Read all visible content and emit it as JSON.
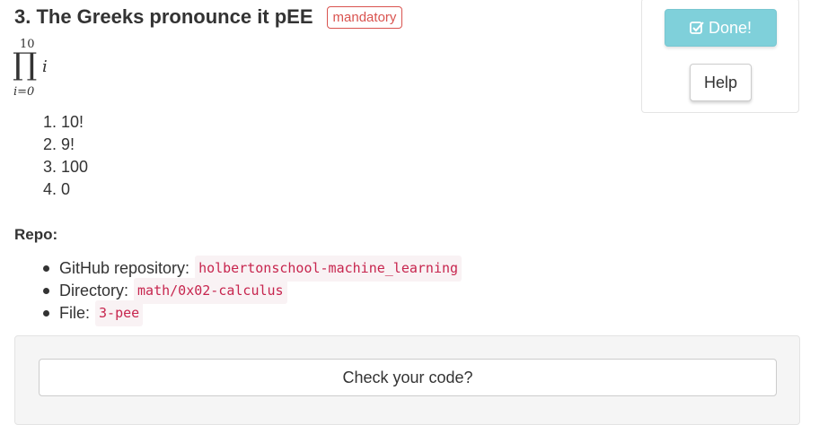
{
  "task": {
    "title": "3. The Greeks pronounce it pEE",
    "badge": "mandatory"
  },
  "side_panel": {
    "done_label": "Done!",
    "help_label": "Help",
    "accent_color": "#7fd0da"
  },
  "formula": {
    "upper_bound": "10",
    "symbol": "∏",
    "variable": "i",
    "lower_bound": "i=0"
  },
  "answers": [
    "1. 10!",
    "2. 9!",
    "3. 100",
    "4. 0"
  ],
  "repo": {
    "label": "Repo:",
    "items": [
      {
        "key": "GitHub repository:",
        "value": "holbertonschool-machine_learning"
      },
      {
        "key": "Directory:",
        "value": "math/0x02-calculus"
      },
      {
        "key": "File:",
        "value": "3-pee"
      }
    ]
  },
  "check": {
    "button_label": "Check your code?"
  }
}
